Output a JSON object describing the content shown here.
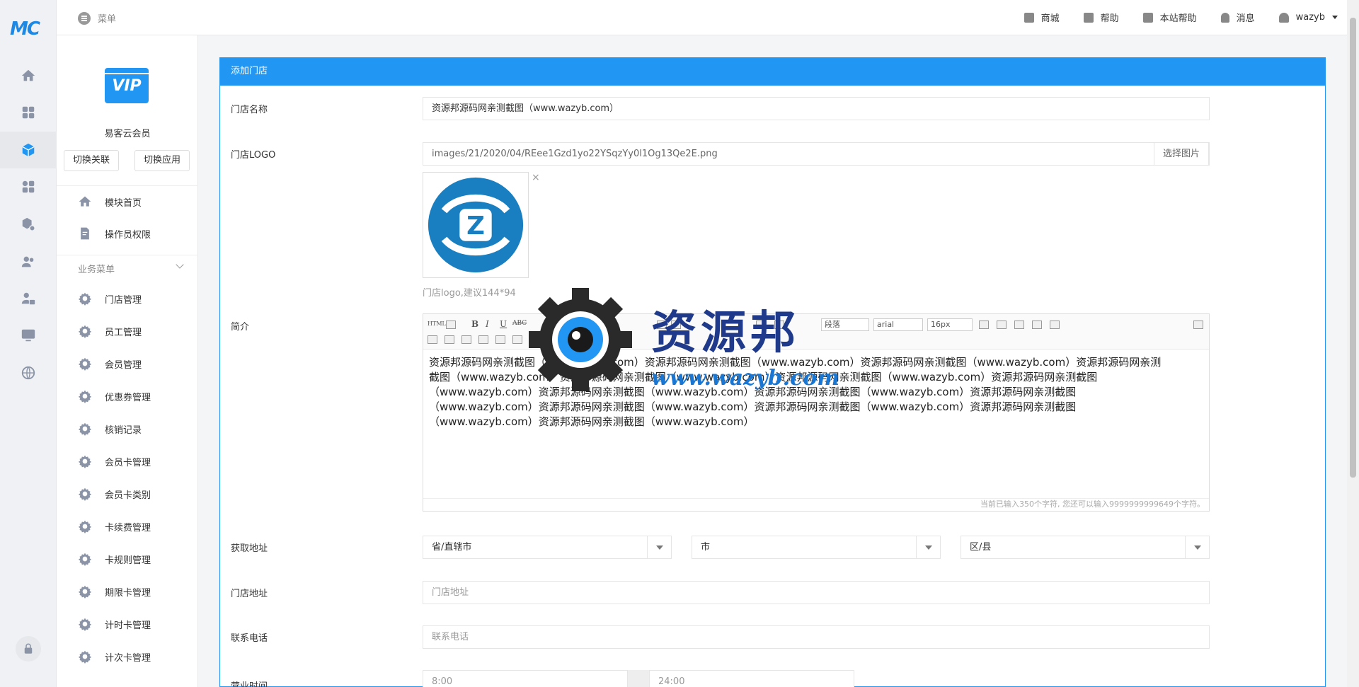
{
  "brand": {
    "logo_text": "MC"
  },
  "topbar": {
    "menu_label": "菜单",
    "nav": [
      {
        "label": "商城",
        "icon": "store-icon"
      },
      {
        "label": "帮助",
        "icon": "help-icon"
      },
      {
        "label": "本站帮助",
        "icon": "site-help-icon"
      },
      {
        "label": "消息",
        "icon": "bell-icon"
      },
      {
        "label": "wazyb",
        "icon": "user-icon"
      }
    ]
  },
  "sidebar": {
    "app_logo_text": "VIP",
    "app_name": "易客云会员",
    "switch_link": "切换关联",
    "switch_app": "切换应用",
    "top_items": [
      {
        "label": "模块首页",
        "icon": "home-icon"
      },
      {
        "label": "操作员权限",
        "icon": "doc-edit-icon"
      }
    ],
    "group_title": "业务菜单",
    "items": [
      "门店管理",
      "员工管理",
      "会员管理",
      "优惠券管理",
      "核销记录",
      "会员卡管理",
      "会员卡类别",
      "卡续费管理",
      "卡规则管理",
      "期限卡管理",
      "计时卡管理",
      "计次卡管理"
    ]
  },
  "panel": {
    "title": "添加门店",
    "store_name_label": "门店名称",
    "store_name_value": "资源邦源码网亲测截图（www.wazyb.com）",
    "logo_label": "门店LOGO",
    "logo_path": "images/21/2020/04/REee1Gzd1yo22YSqzYy0l1Og13Qe2E.png",
    "logo_button": "选择图片",
    "logo_close": "×",
    "logo_hint": "门店logo,建议144*94",
    "intro_label": "简介",
    "editor": {
      "html_btn": "HTML",
      "bold": "B",
      "italic": "I",
      "underline": "U",
      "strike": "ABC",
      "paragraph": "段落",
      "font": "arial",
      "size": "16px",
      "content_lines": [
        "资源邦源码网亲测截图（www.wazyb.com）资源邦源码网亲测截图（www.wazyb.com）资源邦源码网亲测截图（www.wazyb.com）资源邦源码网亲测",
        "截图（www.wazyb.com）资源邦源码网亲测截图（www.wazyb.com）资源邦源码网亲测截图（www.wazyb.com）资源邦源码网亲测截图",
        "（www.wazyb.com）资源邦源码网亲测截图（www.wazyb.com）资源邦源码网亲测截图（www.wazyb.com）资源邦源码网亲测截图",
        "（www.wazyb.com）资源邦源码网亲测截图（www.wazyb.com）资源邦源码网亲测截图（www.wazyb.com）资源邦源码网亲测截图",
        "（www.wazyb.com）资源邦源码网亲测截图（www.wazyb.com）"
      ],
      "count_text": "当前已输入350个字符, 您还可以输入9999999999649个字符。"
    },
    "address_label": "获取地址",
    "province": "省/直辖市",
    "city": "市",
    "district": "区/县",
    "store_address_label": "门店地址",
    "store_address_placeholder": "门店地址",
    "phone_label": "联系电话",
    "phone_placeholder": "联系电话",
    "hours_label": "营业时间",
    "hours_start": "8:00",
    "hours_end": "24:00"
  },
  "watermark": {
    "title": "资源邦",
    "url": "www.wazyb.com"
  },
  "colors": {
    "accent": "#2196f3",
    "brand": "#1e88e5"
  }
}
